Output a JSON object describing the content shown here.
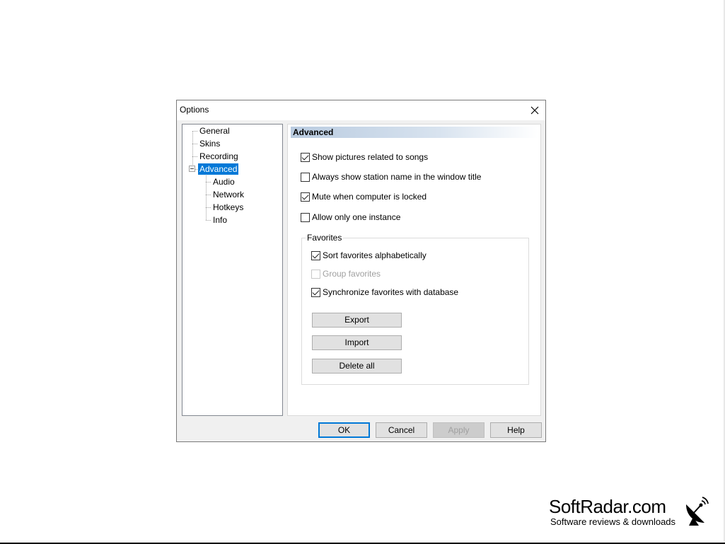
{
  "dialog": {
    "title": "Options",
    "close_icon": "close-icon"
  },
  "tree": {
    "items": [
      {
        "label": "General",
        "level": 0,
        "selected": false
      },
      {
        "label": "Skins",
        "level": 0,
        "selected": false
      },
      {
        "label": "Recording",
        "level": 0,
        "selected": false
      },
      {
        "label": "Advanced",
        "level": 0,
        "selected": true,
        "expanded": true
      },
      {
        "label": "Audio",
        "level": 1,
        "selected": false
      },
      {
        "label": "Network",
        "level": 1,
        "selected": false
      },
      {
        "label": "Hotkeys",
        "level": 1,
        "selected": false
      },
      {
        "label": "Info",
        "level": 1,
        "selected": false
      }
    ]
  },
  "panel": {
    "header": "Advanced",
    "options": [
      {
        "label": "Show pictures related to songs",
        "checked": true
      },
      {
        "label": "Always show station name in the window title",
        "checked": false
      },
      {
        "label": "Mute when computer is locked",
        "checked": true
      },
      {
        "label": "Allow only one instance",
        "checked": false
      }
    ],
    "favorites": {
      "label": "Favorites",
      "options": [
        {
          "label": "Sort favorites alphabetically",
          "checked": true,
          "enabled": true
        },
        {
          "label": "Group favorites",
          "checked": false,
          "enabled": false
        },
        {
          "label": "Synchronize favorites with database",
          "checked": true,
          "enabled": true
        }
      ],
      "buttons": {
        "export": "Export",
        "import": "Import",
        "delete_all": "Delete all"
      }
    }
  },
  "footer": {
    "ok": "OK",
    "cancel": "Cancel",
    "apply": "Apply",
    "help": "Help"
  },
  "watermark": {
    "brand": "SoftRadar.com",
    "tagline": "Software reviews & downloads",
    "icon": "satellite-dish-icon"
  },
  "colors": {
    "selection": "#0078d7",
    "dialog_bg": "#f0f0f0",
    "button_bg": "#e1e1e1"
  }
}
